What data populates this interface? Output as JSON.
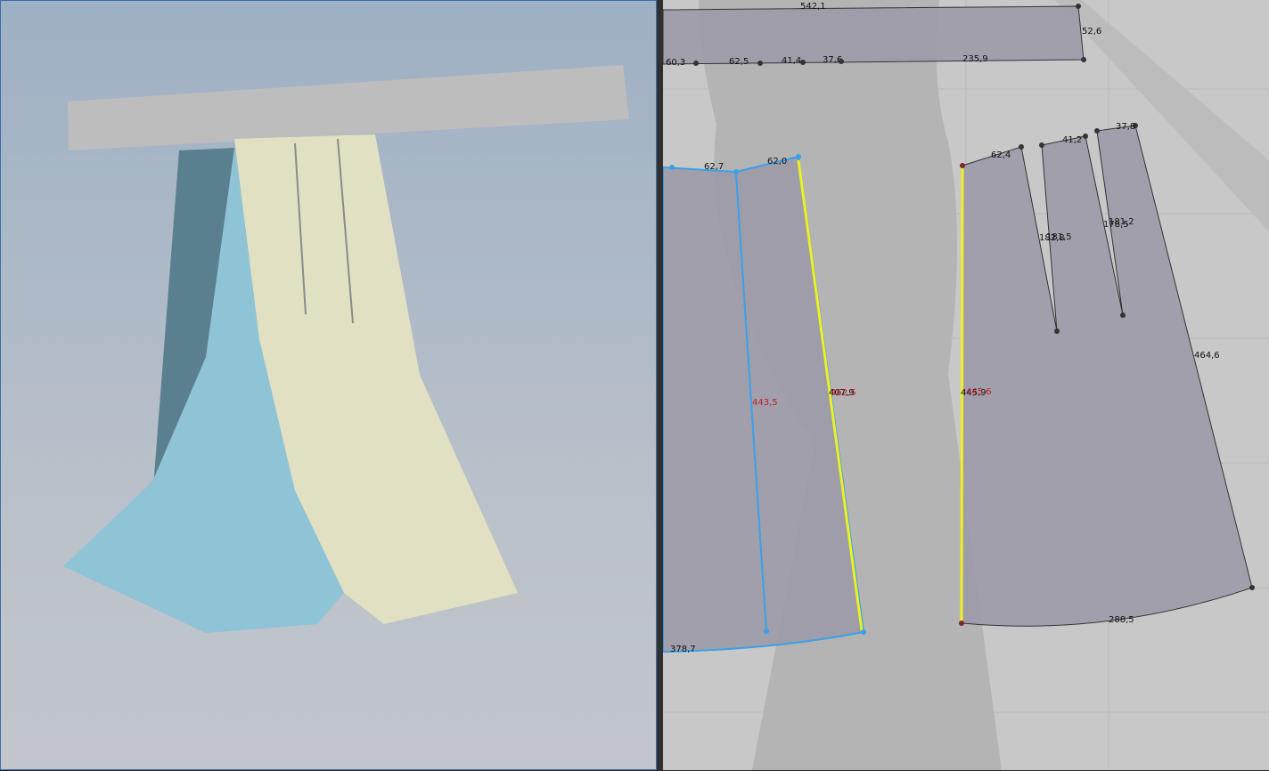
{
  "viewport_3d": {
    "label": "3D garment view"
  },
  "viewport_2d": {
    "waistband": {
      "top": "542,1",
      "side": "52,6",
      "bottom_segments": [
        "60,3",
        "62,5",
        "41,4",
        "37,6",
        "235,9"
      ]
    },
    "front_panel": {
      "top_segments": [
        "62,7",
        "62,0"
      ],
      "seam_left": "443,5",
      "seam_right_a": "407,9",
      "seam_right_b": "462,5",
      "hem": "378,7"
    },
    "back_panel": {
      "top_segments": [
        "62,4",
        "41,2",
        "37,8"
      ],
      "dart1_a": "182,8",
      "dart1_b": "181,5",
      "dart2_a": "178,5",
      "dart2_b": "181,2",
      "side": "464,6",
      "center_a": "445,9",
      "center_b": "445,6",
      "hem": "288,5"
    }
  },
  "colors": {
    "panel": "#9c9aa8",
    "selected": "#3aa0e8",
    "seam_highlight": "#f0f020"
  }
}
